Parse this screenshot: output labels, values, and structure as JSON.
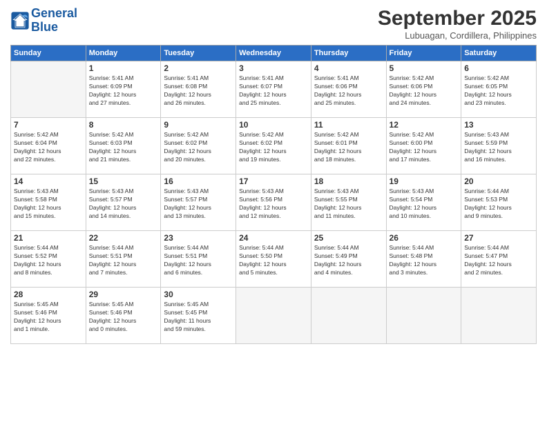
{
  "logo": {
    "line1": "General",
    "line2": "Blue"
  },
  "title": "September 2025",
  "subtitle": "Lubuagan, Cordillera, Philippines",
  "days_of_week": [
    "Sunday",
    "Monday",
    "Tuesday",
    "Wednesday",
    "Thursday",
    "Friday",
    "Saturday"
  ],
  "weeks": [
    [
      {
        "day": "",
        "info": ""
      },
      {
        "day": "1",
        "info": "Sunrise: 5:41 AM\nSunset: 6:09 PM\nDaylight: 12 hours\nand 27 minutes."
      },
      {
        "day": "2",
        "info": "Sunrise: 5:41 AM\nSunset: 6:08 PM\nDaylight: 12 hours\nand 26 minutes."
      },
      {
        "day": "3",
        "info": "Sunrise: 5:41 AM\nSunset: 6:07 PM\nDaylight: 12 hours\nand 25 minutes."
      },
      {
        "day": "4",
        "info": "Sunrise: 5:41 AM\nSunset: 6:06 PM\nDaylight: 12 hours\nand 25 minutes."
      },
      {
        "day": "5",
        "info": "Sunrise: 5:42 AM\nSunset: 6:06 PM\nDaylight: 12 hours\nand 24 minutes."
      },
      {
        "day": "6",
        "info": "Sunrise: 5:42 AM\nSunset: 6:05 PM\nDaylight: 12 hours\nand 23 minutes."
      }
    ],
    [
      {
        "day": "7",
        "info": "Sunrise: 5:42 AM\nSunset: 6:04 PM\nDaylight: 12 hours\nand 22 minutes."
      },
      {
        "day": "8",
        "info": "Sunrise: 5:42 AM\nSunset: 6:03 PM\nDaylight: 12 hours\nand 21 minutes."
      },
      {
        "day": "9",
        "info": "Sunrise: 5:42 AM\nSunset: 6:02 PM\nDaylight: 12 hours\nand 20 minutes."
      },
      {
        "day": "10",
        "info": "Sunrise: 5:42 AM\nSunset: 6:02 PM\nDaylight: 12 hours\nand 19 minutes."
      },
      {
        "day": "11",
        "info": "Sunrise: 5:42 AM\nSunset: 6:01 PM\nDaylight: 12 hours\nand 18 minutes."
      },
      {
        "day": "12",
        "info": "Sunrise: 5:42 AM\nSunset: 6:00 PM\nDaylight: 12 hours\nand 17 minutes."
      },
      {
        "day": "13",
        "info": "Sunrise: 5:43 AM\nSunset: 5:59 PM\nDaylight: 12 hours\nand 16 minutes."
      }
    ],
    [
      {
        "day": "14",
        "info": "Sunrise: 5:43 AM\nSunset: 5:58 PM\nDaylight: 12 hours\nand 15 minutes."
      },
      {
        "day": "15",
        "info": "Sunrise: 5:43 AM\nSunset: 5:57 PM\nDaylight: 12 hours\nand 14 minutes."
      },
      {
        "day": "16",
        "info": "Sunrise: 5:43 AM\nSunset: 5:57 PM\nDaylight: 12 hours\nand 13 minutes."
      },
      {
        "day": "17",
        "info": "Sunrise: 5:43 AM\nSunset: 5:56 PM\nDaylight: 12 hours\nand 12 minutes."
      },
      {
        "day": "18",
        "info": "Sunrise: 5:43 AM\nSunset: 5:55 PM\nDaylight: 12 hours\nand 11 minutes."
      },
      {
        "day": "19",
        "info": "Sunrise: 5:43 AM\nSunset: 5:54 PM\nDaylight: 12 hours\nand 10 minutes."
      },
      {
        "day": "20",
        "info": "Sunrise: 5:44 AM\nSunset: 5:53 PM\nDaylight: 12 hours\nand 9 minutes."
      }
    ],
    [
      {
        "day": "21",
        "info": "Sunrise: 5:44 AM\nSunset: 5:52 PM\nDaylight: 12 hours\nand 8 minutes."
      },
      {
        "day": "22",
        "info": "Sunrise: 5:44 AM\nSunset: 5:51 PM\nDaylight: 12 hours\nand 7 minutes."
      },
      {
        "day": "23",
        "info": "Sunrise: 5:44 AM\nSunset: 5:51 PM\nDaylight: 12 hours\nand 6 minutes."
      },
      {
        "day": "24",
        "info": "Sunrise: 5:44 AM\nSunset: 5:50 PM\nDaylight: 12 hours\nand 5 minutes."
      },
      {
        "day": "25",
        "info": "Sunrise: 5:44 AM\nSunset: 5:49 PM\nDaylight: 12 hours\nand 4 minutes."
      },
      {
        "day": "26",
        "info": "Sunrise: 5:44 AM\nSunset: 5:48 PM\nDaylight: 12 hours\nand 3 minutes."
      },
      {
        "day": "27",
        "info": "Sunrise: 5:44 AM\nSunset: 5:47 PM\nDaylight: 12 hours\nand 2 minutes."
      }
    ],
    [
      {
        "day": "28",
        "info": "Sunrise: 5:45 AM\nSunset: 5:46 PM\nDaylight: 12 hours\nand 1 minute."
      },
      {
        "day": "29",
        "info": "Sunrise: 5:45 AM\nSunset: 5:46 PM\nDaylight: 12 hours\nand 0 minutes."
      },
      {
        "day": "30",
        "info": "Sunrise: 5:45 AM\nSunset: 5:45 PM\nDaylight: 11 hours\nand 59 minutes."
      },
      {
        "day": "",
        "info": ""
      },
      {
        "day": "",
        "info": ""
      },
      {
        "day": "",
        "info": ""
      },
      {
        "day": "",
        "info": ""
      }
    ]
  ]
}
